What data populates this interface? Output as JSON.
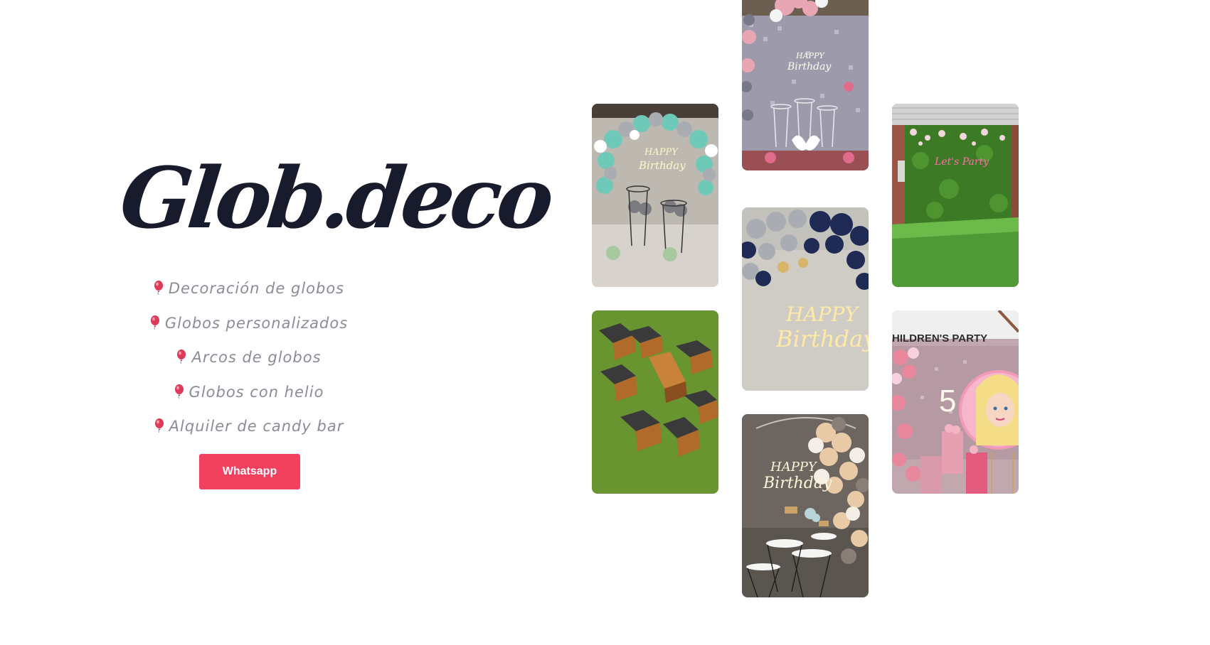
{
  "brand": {
    "logo_text": "Glob.deco"
  },
  "services": [
    {
      "icon": "balloon-icon",
      "label": "Decoración de globos"
    },
    {
      "icon": "balloon-icon",
      "label": "Globos personalizados"
    },
    {
      "icon": "balloon-icon",
      "label": "Arcos de globos"
    },
    {
      "icon": "balloon-icon",
      "label": "Globos con helio"
    },
    {
      "icon": "balloon-icon",
      "label": "Alquiler de candy bar"
    }
  ],
  "cta": {
    "label": "Whatsapp",
    "color": "#f2405f"
  },
  "gallery": {
    "photo_1": {
      "neon_1": "HAPPY",
      "neon_2": "Birthday"
    },
    "photo_3": {
      "neon_1": "HAPPY",
      "neon_2": "Birthday"
    },
    "photo_4": {
      "neon_1": "HAPPY",
      "neon_2": "Birthday"
    },
    "photo_5": {
      "neon_1": "HAPPY",
      "neon_2": "Birthday"
    },
    "photo_6": {
      "neon_1": "Let's Party"
    },
    "photo_7": {
      "banner": "HILDREN'S PARTY",
      "number": "5"
    }
  },
  "colors": {
    "logo": "#171b2b",
    "text": "#8a8d96",
    "accent": "#f2405f"
  }
}
